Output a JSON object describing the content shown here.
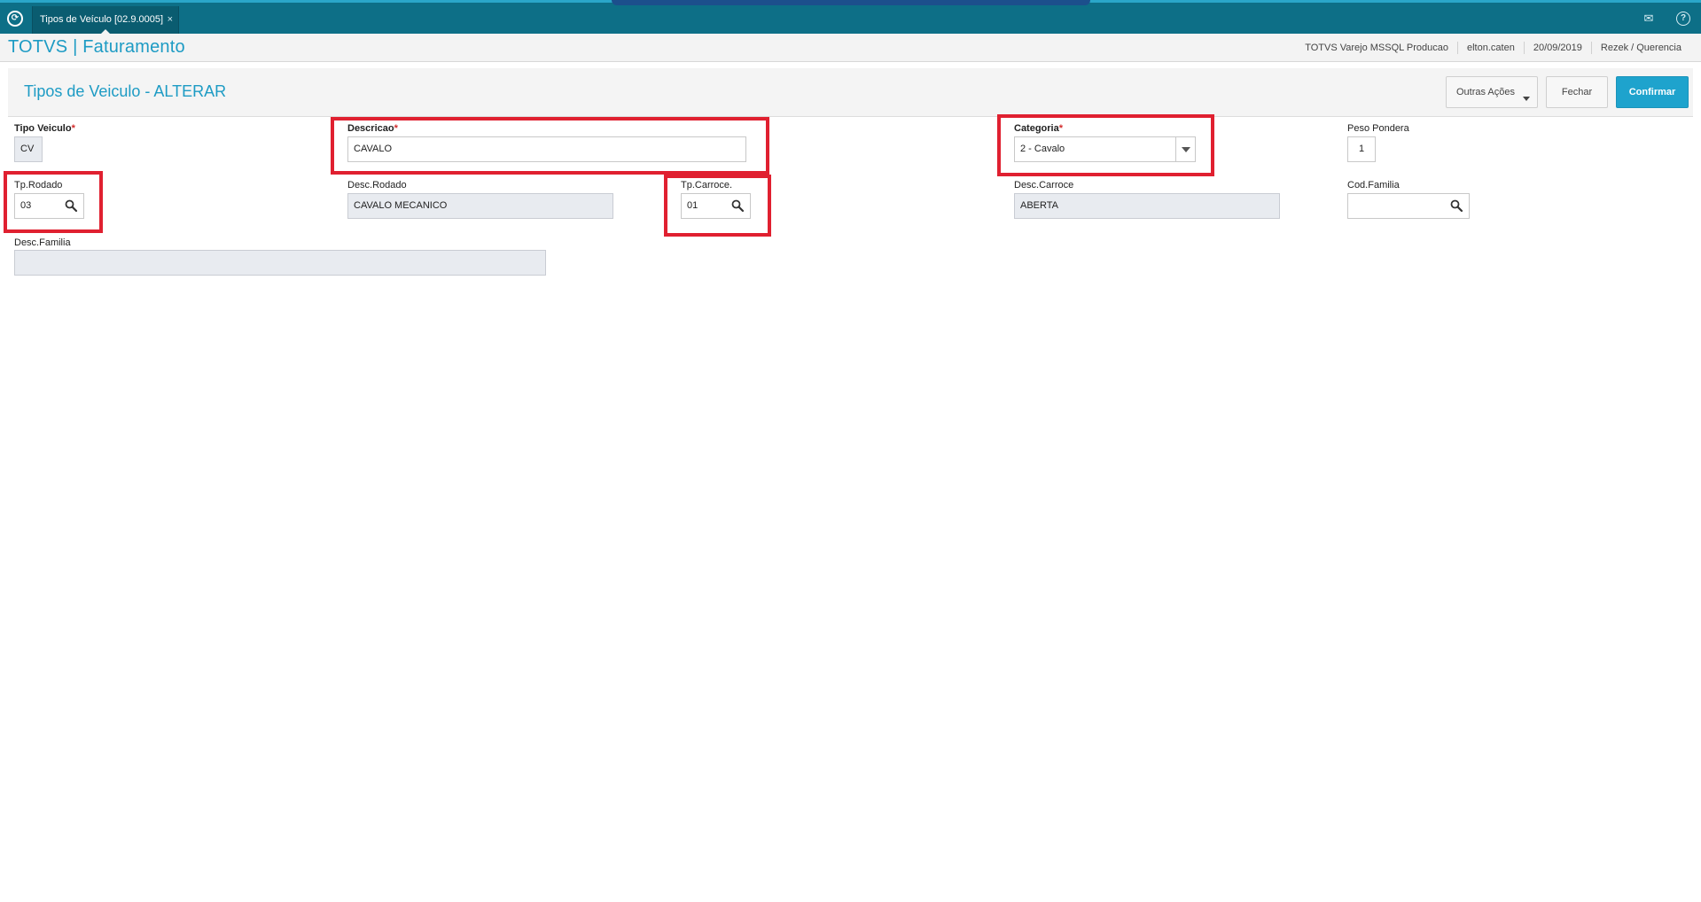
{
  "window": {
    "tab_label": "Tipos de Veículo [02.9.0005]",
    "tab_close": "×"
  },
  "header": {
    "brand": "TOTVS | Faturamento",
    "info": [
      "TOTVS Varejo MSSQL Producao",
      "elton.caten",
      "20/09/2019",
      "Rezek / Querencia"
    ]
  },
  "page": {
    "title": "Tipos de Veiculo - ALTERAR",
    "buttons": {
      "outras": "Outras Ações",
      "fechar": "Fechar",
      "confirmar": "Confirmar"
    }
  },
  "form": {
    "tipo_veiculo": {
      "label": "Tipo Veiculo",
      "value": "CV"
    },
    "descricao": {
      "label": "Descricao",
      "value": "CAVALO"
    },
    "categoria": {
      "label": "Categoria",
      "value": "2 - Cavalo"
    },
    "peso_pondera": {
      "label": "Peso Pondera",
      "value": "1"
    },
    "tp_rodado": {
      "label": "Tp.Rodado",
      "value": "03"
    },
    "desc_rodado": {
      "label": "Desc.Rodado",
      "value": "CAVALO MECANICO"
    },
    "tp_carroce": {
      "label": "Tp.Carroce.",
      "value": "01"
    },
    "desc_carroce": {
      "label": "Desc.Carroce",
      "value": "ABERTA"
    },
    "cod_familia": {
      "label": "Cod.Familia",
      "value": ""
    },
    "desc_familia": {
      "label": "Desc.Familia",
      "value": ""
    }
  },
  "required_marker": "*",
  "colors": {
    "topbar": "#0d6f87",
    "brand": "#1d9bc4",
    "confirm": "#1ea3cd",
    "highlight": "#e02030",
    "readonly_bg": "#e8ebf0"
  },
  "icons": {
    "app": "refresh-circle-icon",
    "lookup": "magnifier-icon",
    "mail": "mail-icon",
    "help": "help-icon"
  }
}
